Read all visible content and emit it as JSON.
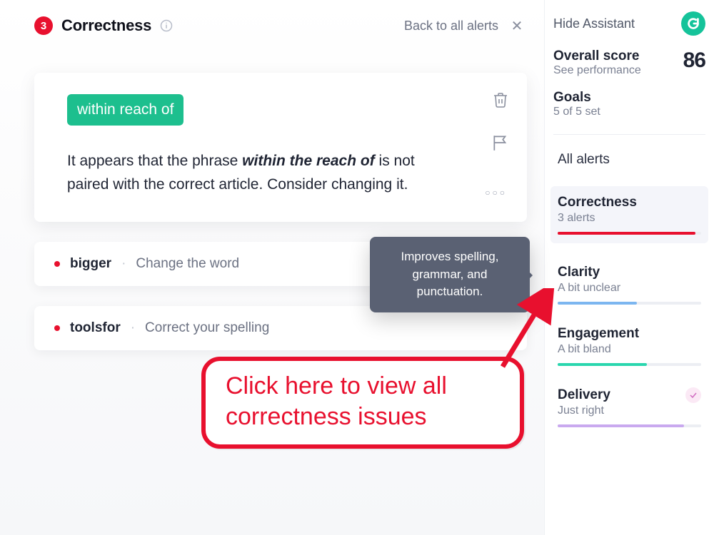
{
  "header": {
    "count": "3",
    "title": "Correctness",
    "back_label": "Back to all alerts"
  },
  "main_card": {
    "suggestion_pill": "within reach of",
    "body_prefix": "It appears that the phrase ",
    "body_emph": "within the reach of",
    "body_suffix": " is not paired with the correct article. Consider changing it."
  },
  "alerts": [
    {
      "word": "bigger",
      "message": "Change the word"
    },
    {
      "word": "toolsfor",
      "message": "Correct your spelling"
    }
  ],
  "tooltip": "Improves spelling, grammar, and punctuation.",
  "sidebar": {
    "hide_label": "Hide Assistant",
    "score_label": "Overall score",
    "score_sub": "See performance",
    "score_value": "86",
    "goals_label": "Goals",
    "goals_sub": "5 of 5 set",
    "all_alerts": "All alerts",
    "categories": [
      {
        "name": "Correctness",
        "sub": "3 alerts",
        "color": "#E8102E",
        "fill_pct": 96,
        "active": true
      },
      {
        "name": "Clarity",
        "sub": "A bit unclear",
        "color": "#7CB6F0",
        "fill_pct": 55,
        "active": false
      },
      {
        "name": "Engagement",
        "sub": "A bit bland",
        "color": "#2AD6AE",
        "fill_pct": 62,
        "active": false
      },
      {
        "name": "Delivery",
        "sub": "Just right",
        "color": "#C9A9EF",
        "fill_pct": 88,
        "active": false,
        "badge": true
      }
    ]
  },
  "annotation": {
    "callout_line1": "Click here to view all",
    "callout_line2": "correctness issues"
  }
}
